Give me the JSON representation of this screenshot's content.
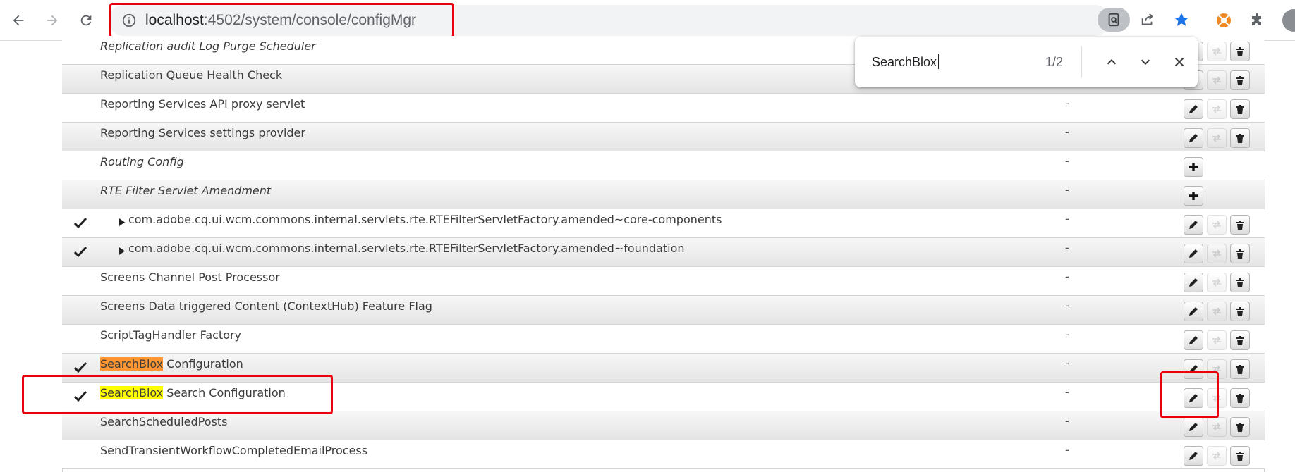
{
  "browser": {
    "url_host": "localhost",
    "url_path": ":4502/system/console/configMgr",
    "star_color": "#1a73e8"
  },
  "find_bar": {
    "query": "SearchBlox",
    "count": "1/2"
  },
  "colors": {
    "annotation": "#e8000f",
    "highlight_current": "#ff9632",
    "highlight_match": "#ffff00"
  },
  "rows": [
    {
      "name": "Replication audit Log Purge Scheduler",
      "italic": true,
      "checked": false,
      "indent": false,
      "dash": "",
      "actions": "full"
    },
    {
      "name": "Replication Queue Health Check",
      "italic": false,
      "checked": false,
      "indent": false,
      "dash": "",
      "actions": "full"
    },
    {
      "name": "Reporting Services API proxy servlet",
      "italic": false,
      "checked": false,
      "indent": false,
      "dash": "-",
      "actions": "full"
    },
    {
      "name": "Reporting Services settings provider",
      "italic": false,
      "checked": false,
      "indent": false,
      "dash": "-",
      "actions": "full"
    },
    {
      "name": "Routing Config",
      "italic": true,
      "checked": false,
      "indent": false,
      "dash": "-",
      "actions": "add"
    },
    {
      "name": "RTE Filter Servlet Amendment",
      "italic": true,
      "checked": false,
      "indent": false,
      "dash": "-",
      "actions": "add"
    },
    {
      "name": "com.adobe.cq.ui.wcm.commons.internal.servlets.rte.RTEFilterServletFactory.amended~core-components",
      "italic": false,
      "checked": true,
      "indent": true,
      "dash": "-",
      "actions": "full"
    },
    {
      "name": "com.adobe.cq.ui.wcm.commons.internal.servlets.rte.RTEFilterServletFactory.amended~foundation",
      "italic": false,
      "checked": true,
      "indent": true,
      "dash": "-",
      "actions": "full"
    },
    {
      "name": "Screens Channel Post Processor",
      "italic": false,
      "checked": false,
      "indent": false,
      "dash": "-",
      "actions": "full"
    },
    {
      "name": "Screens Data triggered Content (ContextHub) Feature Flag",
      "italic": false,
      "checked": false,
      "indent": false,
      "dash": "-",
      "actions": "full"
    },
    {
      "name": "ScriptTagHandler Factory",
      "italic": false,
      "checked": false,
      "indent": false,
      "dash": "-",
      "actions": "full"
    },
    {
      "name": "Configuration",
      "hl": "SearchBlox",
      "hl_type": "current",
      "italic": false,
      "checked": true,
      "indent": false,
      "dash": "-",
      "actions": "full"
    },
    {
      "name": "Search Configuration",
      "hl": "SearchBlox",
      "hl_type": "match",
      "italic": false,
      "checked": true,
      "indent": false,
      "dash": "-",
      "actions": "full"
    },
    {
      "name": "SearchScheduledPosts",
      "italic": false,
      "checked": false,
      "indent": false,
      "dash": "-",
      "actions": "full"
    },
    {
      "name": "SendTransientWorkflowCompletedEmailProcess",
      "italic": false,
      "checked": false,
      "indent": false,
      "dash": "-",
      "actions": "full"
    }
  ]
}
